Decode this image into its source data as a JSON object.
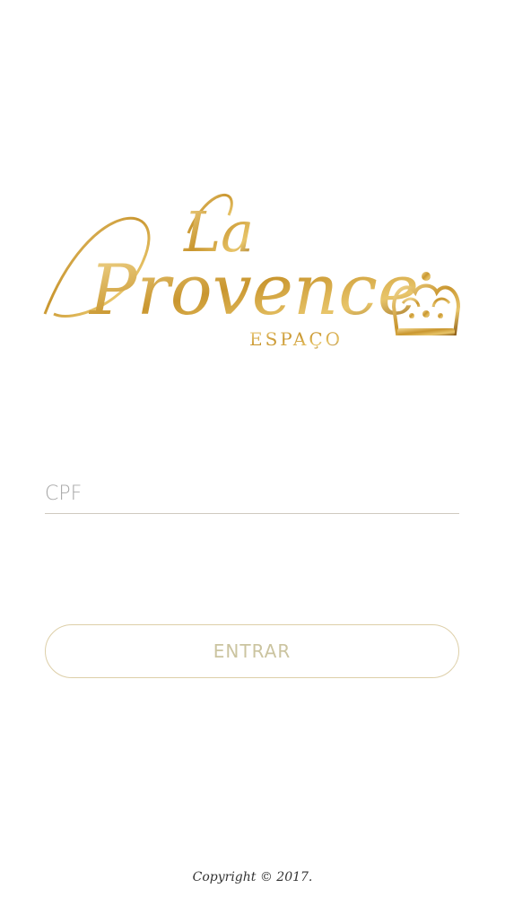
{
  "logo": {
    "line1": "La",
    "line2": "Provence",
    "subtitle": "ESPAÇO",
    "crown_icon": "crown-icon",
    "colors": {
      "gold_light": "#f2d891",
      "gold": "#c9962f",
      "gold_dark": "#8a5a14"
    }
  },
  "form": {
    "cpf": {
      "placeholder": "CPF",
      "value": ""
    },
    "enter_label": "ENTRAR"
  },
  "footer": {
    "copyright": "Copyright © 2017."
  },
  "colors": {
    "background": "#ffffff",
    "input_underline": "#cfcac0",
    "button_border": "#ddcfa8",
    "button_text": "#cbc4a0"
  }
}
